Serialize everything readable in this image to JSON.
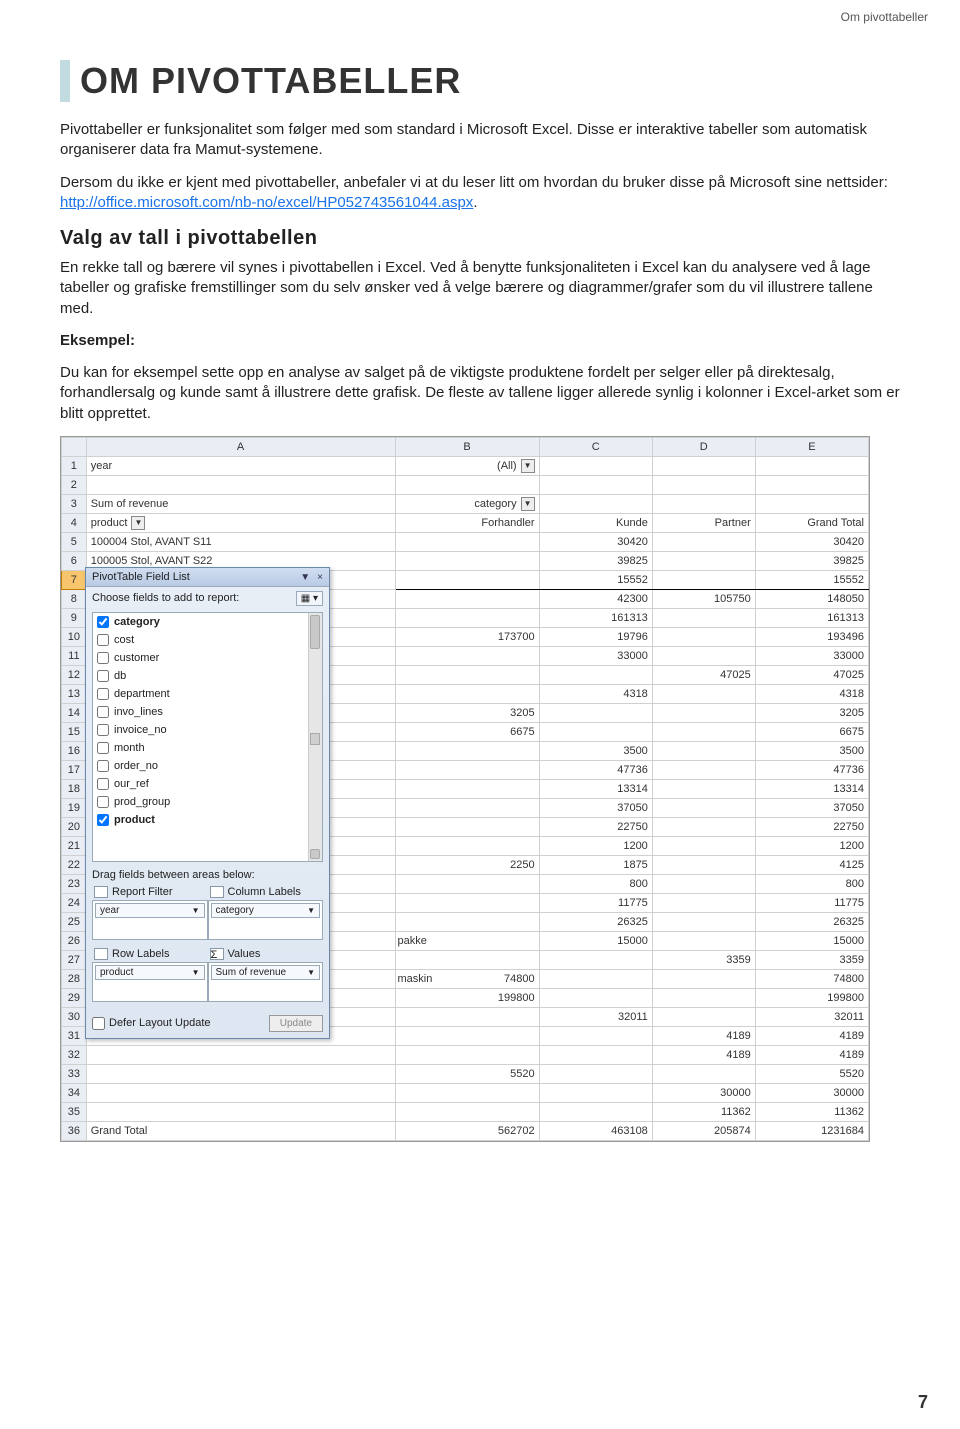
{
  "header_right": "Om pivottabeller",
  "title": "OM PIVOTTABELLER",
  "intro1": "Pivottabeller er funksjonalitet som følger med som standard i Microsoft Excel. Disse er interaktive tabeller som automatisk organiserer data fra Mamut-systemene.",
  "intro2_pre": "Dersom du ikke er kjent med pivottabeller, anbefaler vi at du leser litt om hvordan du bruker disse på Microsoft sine nettsider: ",
  "intro2_link": "http://office.microsoft.com/nb-no/excel/HP052743561044.aspx",
  "intro2_post": ".",
  "section_heading": "Valg av tall i pivottabellen",
  "para1": "En rekke tall og bærere vil synes i pivottabellen i Excel. Ved å benytte funksjonaliteten i Excel kan du analysere ved å lage tabeller og grafiske fremstillinger som du selv ønsker ved å velge bærere og diagrammer/grafer som du vil illustrere tallene med.",
  "example_label": "Eksempel:",
  "para2": "Du kan for eksempel sette opp en analyse av salget på de viktigste produktene fordelt per selger eller på direktesalg, forhandlersalg og kunde samt å illustrere dette grafisk. De fleste av tallene ligger allerede synlig i kolonner i Excel-arket som er blitt opprettet.",
  "excel": {
    "col_headers": [
      "A",
      "B",
      "C",
      "D",
      "E"
    ],
    "rows": [
      {
        "n": "1",
        "A": "year",
        "B": "(All)",
        "drop": true
      },
      {
        "n": "2"
      },
      {
        "n": "3",
        "A": "Sum of revenue",
        "B": "category",
        "drop": true
      },
      {
        "n": "4",
        "A": "product",
        "Adrop": true,
        "B": "Forhandler",
        "C": "Kunde",
        "D": "Partner",
        "E": "Grand Total"
      },
      {
        "n": "5",
        "A": "100004 Stol, AVANT S11",
        "C": "30420",
        "E": "30420"
      },
      {
        "n": "6",
        "A": "100005 Stol, AVANT S22",
        "C": "39825",
        "E": "39825"
      },
      {
        "n": "7",
        "C": "15552",
        "E": "15552",
        "sel": true
      },
      {
        "n": "8",
        "C": "42300",
        "D": "105750",
        "E": "148050"
      },
      {
        "n": "9",
        "C": "161313",
        "E": "161313"
      },
      {
        "n": "10",
        "B": "173700",
        "C": "19796",
        "E": "193496"
      },
      {
        "n": "11",
        "C": "33000",
        "E": "33000"
      },
      {
        "n": "12",
        "D": "47025",
        "E": "47025"
      },
      {
        "n": "13",
        "C": "4318",
        "E": "4318"
      },
      {
        "n": "14",
        "B": "3205",
        "E": "3205"
      },
      {
        "n": "15",
        "B": "6675",
        "E": "6675"
      },
      {
        "n": "16",
        "C": "3500",
        "E": "3500"
      },
      {
        "n": "17",
        "C": "47736",
        "E": "47736"
      },
      {
        "n": "18",
        "C": "13314",
        "E": "13314"
      },
      {
        "n": "19",
        "C": "37050",
        "E": "37050"
      },
      {
        "n": "20",
        "C": "22750",
        "E": "22750"
      },
      {
        "n": "21",
        "C": "1200",
        "E": "1200"
      },
      {
        "n": "22",
        "B": "2250",
        "C": "1875",
        "E": "4125"
      },
      {
        "n": "23",
        "C": "800",
        "E": "800"
      },
      {
        "n": "24",
        "C": "11775",
        "E": "11775"
      },
      {
        "n": "25",
        "C": "26325",
        "E": "26325"
      },
      {
        "n": "26",
        "Bsuffix": "pakke",
        "C": "15000",
        "E": "15000"
      },
      {
        "n": "27",
        "D": "3359",
        "E": "3359"
      },
      {
        "n": "28",
        "Bsuffix": "maskin",
        "B": "74800",
        "E": "74800"
      },
      {
        "n": "29",
        "B": "199800",
        "E": "199800"
      },
      {
        "n": "30",
        "C": "32011",
        "E": "32011"
      },
      {
        "n": "31",
        "D": "4189",
        "E": "4189"
      },
      {
        "n": "32",
        "D": "4189",
        "E": "4189"
      },
      {
        "n": "33",
        "B": "5520",
        "E": "5520"
      },
      {
        "n": "34",
        "D": "30000",
        "E": "30000"
      },
      {
        "n": "35",
        "D": "11362",
        "E": "11362"
      },
      {
        "n": "36",
        "A": "Grand Total",
        "B": "562702",
        "C": "463108",
        "D": "205874",
        "E": "1231684"
      }
    ]
  },
  "panel": {
    "title": "PivotTable Field List",
    "subtitle": "Choose fields to add to report:",
    "fields": [
      {
        "id": "category",
        "label": "category",
        "checked": true
      },
      {
        "id": "cost",
        "label": "cost",
        "checked": false
      },
      {
        "id": "customer",
        "label": "customer",
        "checked": false
      },
      {
        "id": "db",
        "label": "db",
        "checked": false
      },
      {
        "id": "department",
        "label": "department",
        "checked": false
      },
      {
        "id": "invo_lines",
        "label": "invo_lines",
        "checked": false
      },
      {
        "id": "invoice_no",
        "label": "invoice_no",
        "checked": false
      },
      {
        "id": "month",
        "label": "month",
        "checked": false
      },
      {
        "id": "order_no",
        "label": "order_no",
        "checked": false
      },
      {
        "id": "our_ref",
        "label": "our_ref",
        "checked": false
      },
      {
        "id": "prod_group",
        "label": "prod_group",
        "checked": false
      },
      {
        "id": "product",
        "label": "product",
        "checked": true
      }
    ],
    "drag_label": "Drag fields between areas below:",
    "report_filter": "Report Filter",
    "column_labels": "Column Labels",
    "row_labels": "Row Labels",
    "values": "Values",
    "chip_year": "year",
    "chip_category": "category",
    "chip_product": "product",
    "chip_sum": "Sum of revenue",
    "defer_label": "Defer Layout Update",
    "update_btn": "Update",
    "sigma": "Σ"
  },
  "page_number": "7"
}
